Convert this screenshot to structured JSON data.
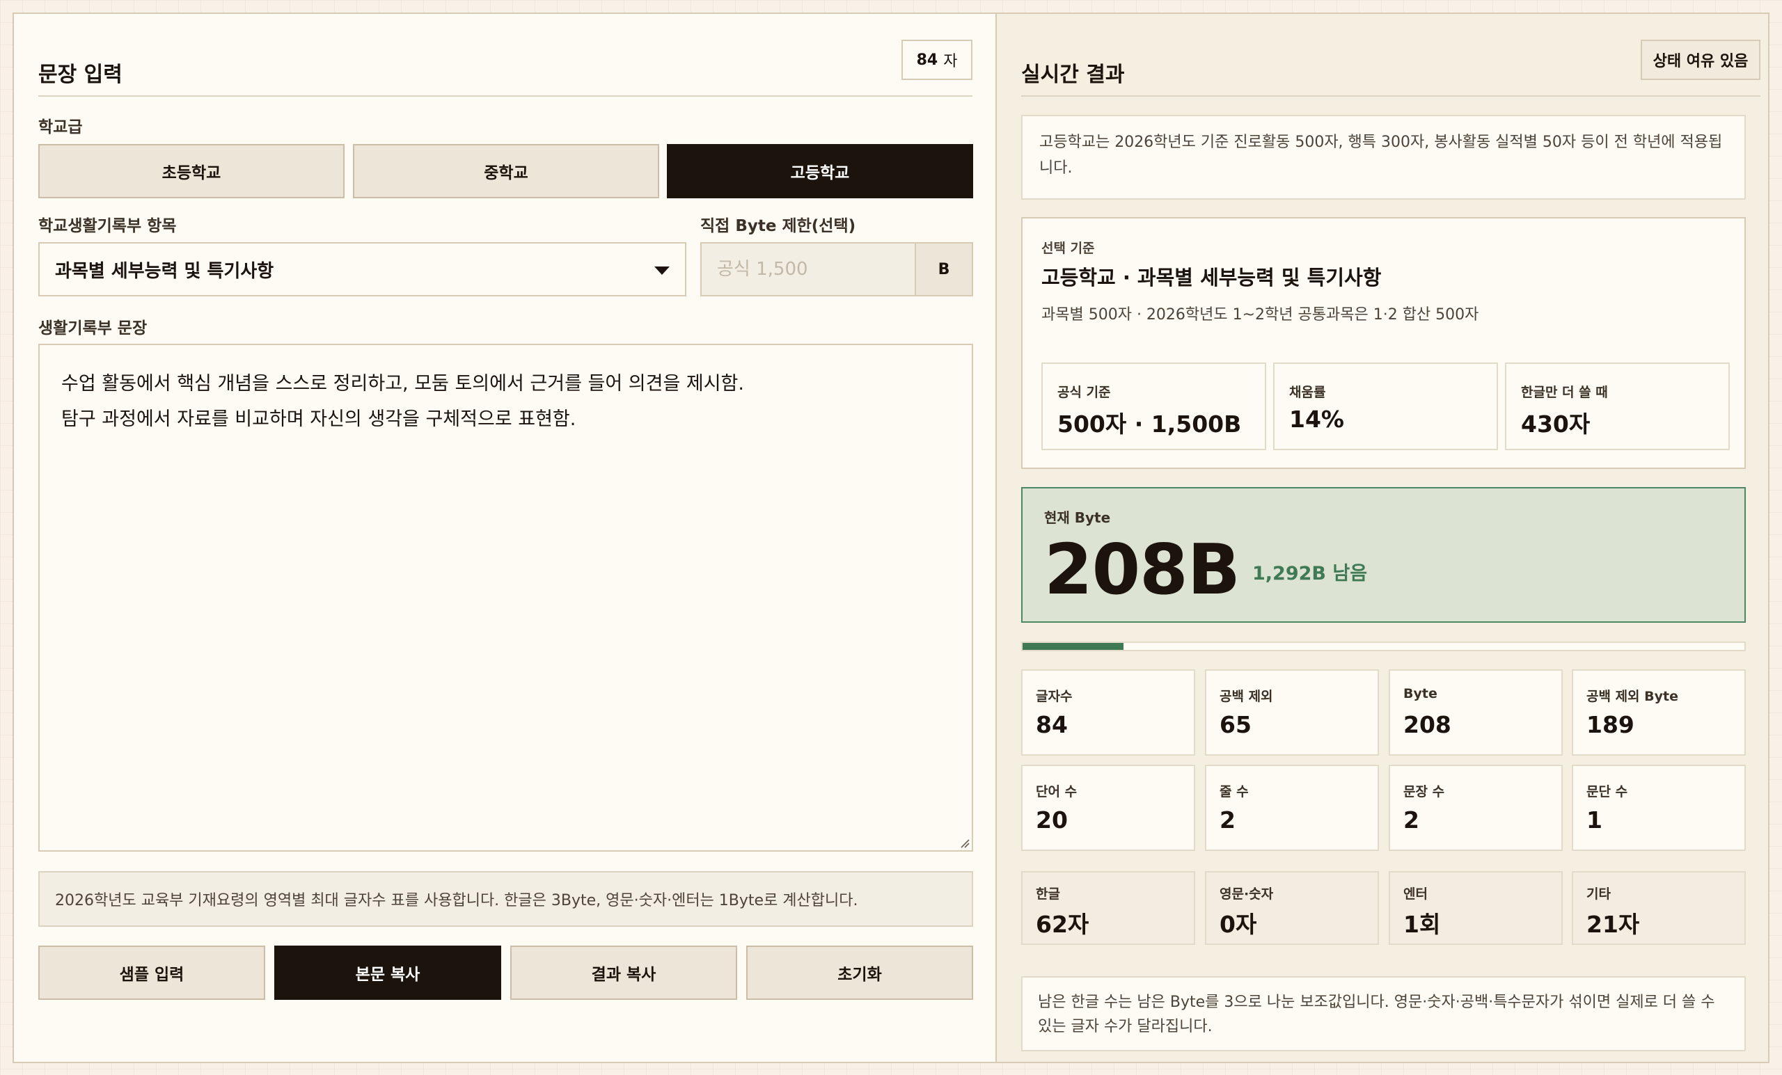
{
  "input_panel": {
    "title": "문장 입력",
    "char_count": "84",
    "char_unit": "자",
    "school_level_label": "학교급",
    "levels": [
      "초등학교",
      "중학교",
      "고등학교"
    ],
    "selected_level": "고등학교",
    "category_label": "학교생활기록부 항목",
    "category_value": "과목별 세부능력 및 특기사항",
    "byte_limit_label": "직접 Byte 제한(선택)",
    "byte_limit_placeholder": "공식 1,500",
    "byte_limit_unit": "B",
    "text_label": "생활기록부 문장",
    "text_lines": [
      "수업 활동에서 핵심 개념을 스스로 정리하고, 모둠 토의에서 근거를 들어 의견을 제시함.",
      "탐구 과정에서 자료를 비교하며 자신의 생각을 구체적으로 표현함."
    ],
    "info": "2026학년도 교육부 기재요령의 영역별 최대 글자수 표를 사용합니다. 한글은 3Byte, 영문·숫자·엔터는 1Byte로 계산합니다.",
    "actions": [
      "샘플 입력",
      "본문 복사",
      "결과 복사",
      "초기화"
    ]
  },
  "result_panel": {
    "title": "실시간 결과",
    "status": "상태 여유 있음",
    "notice": "고등학교는 2026학년도 기준 진로활동 500자, 행특 300자, 봉사활동 실적별 50자 등이 전 학년에 적용됩니다.",
    "criteria": {
      "kicker": "선택 기준",
      "title": "고등학교 · 과목별 세부능력 및 특기사항",
      "desc": "과목별 500자 · 2026학년도 1~2학년 공통과목은 1·2 합산 500자",
      "stats": [
        {
          "label": "공식 기준",
          "value": "500자 · 1,500B"
        },
        {
          "label": "채움률",
          "value": "14%"
        },
        {
          "label": "한글만 더 쓸 때",
          "value": "430자"
        }
      ]
    },
    "current_byte": {
      "label": "현재 Byte",
      "value": "208B",
      "remaining": "1,292B 남음"
    },
    "progress_fraction": 0.14,
    "metrics": [
      {
        "label": "글자수",
        "value": "84"
      },
      {
        "label": "공백 제외",
        "value": "65"
      },
      {
        "label": "Byte",
        "value": "208"
      },
      {
        "label": "공백 제외 Byte",
        "value": "189"
      },
      {
        "label": "단어 수",
        "value": "20"
      },
      {
        "label": "줄 수",
        "value": "2"
      },
      {
        "label": "문장 수",
        "value": "2"
      },
      {
        "label": "문단 수",
        "value": "1"
      }
    ],
    "char_types": [
      {
        "label": "한글",
        "value": "62자"
      },
      {
        "label": "영문·숫자",
        "value": "0자"
      },
      {
        "label": "엔터",
        "value": "1회"
      },
      {
        "label": "기타",
        "value": "21자"
      }
    ],
    "footnote": "남은 한글 수는 남은 Byte를 3으로 나눈 보조값입니다. 영문·숫자·공백·특수문자가 섞이면 실제로 더 쓸 수 있는 글자 수가 달라집니다."
  },
  "colors": {
    "accent_green": "#3f7a55",
    "dark": "#1c140c",
    "card_green_bg": "#dce3d2"
  }
}
